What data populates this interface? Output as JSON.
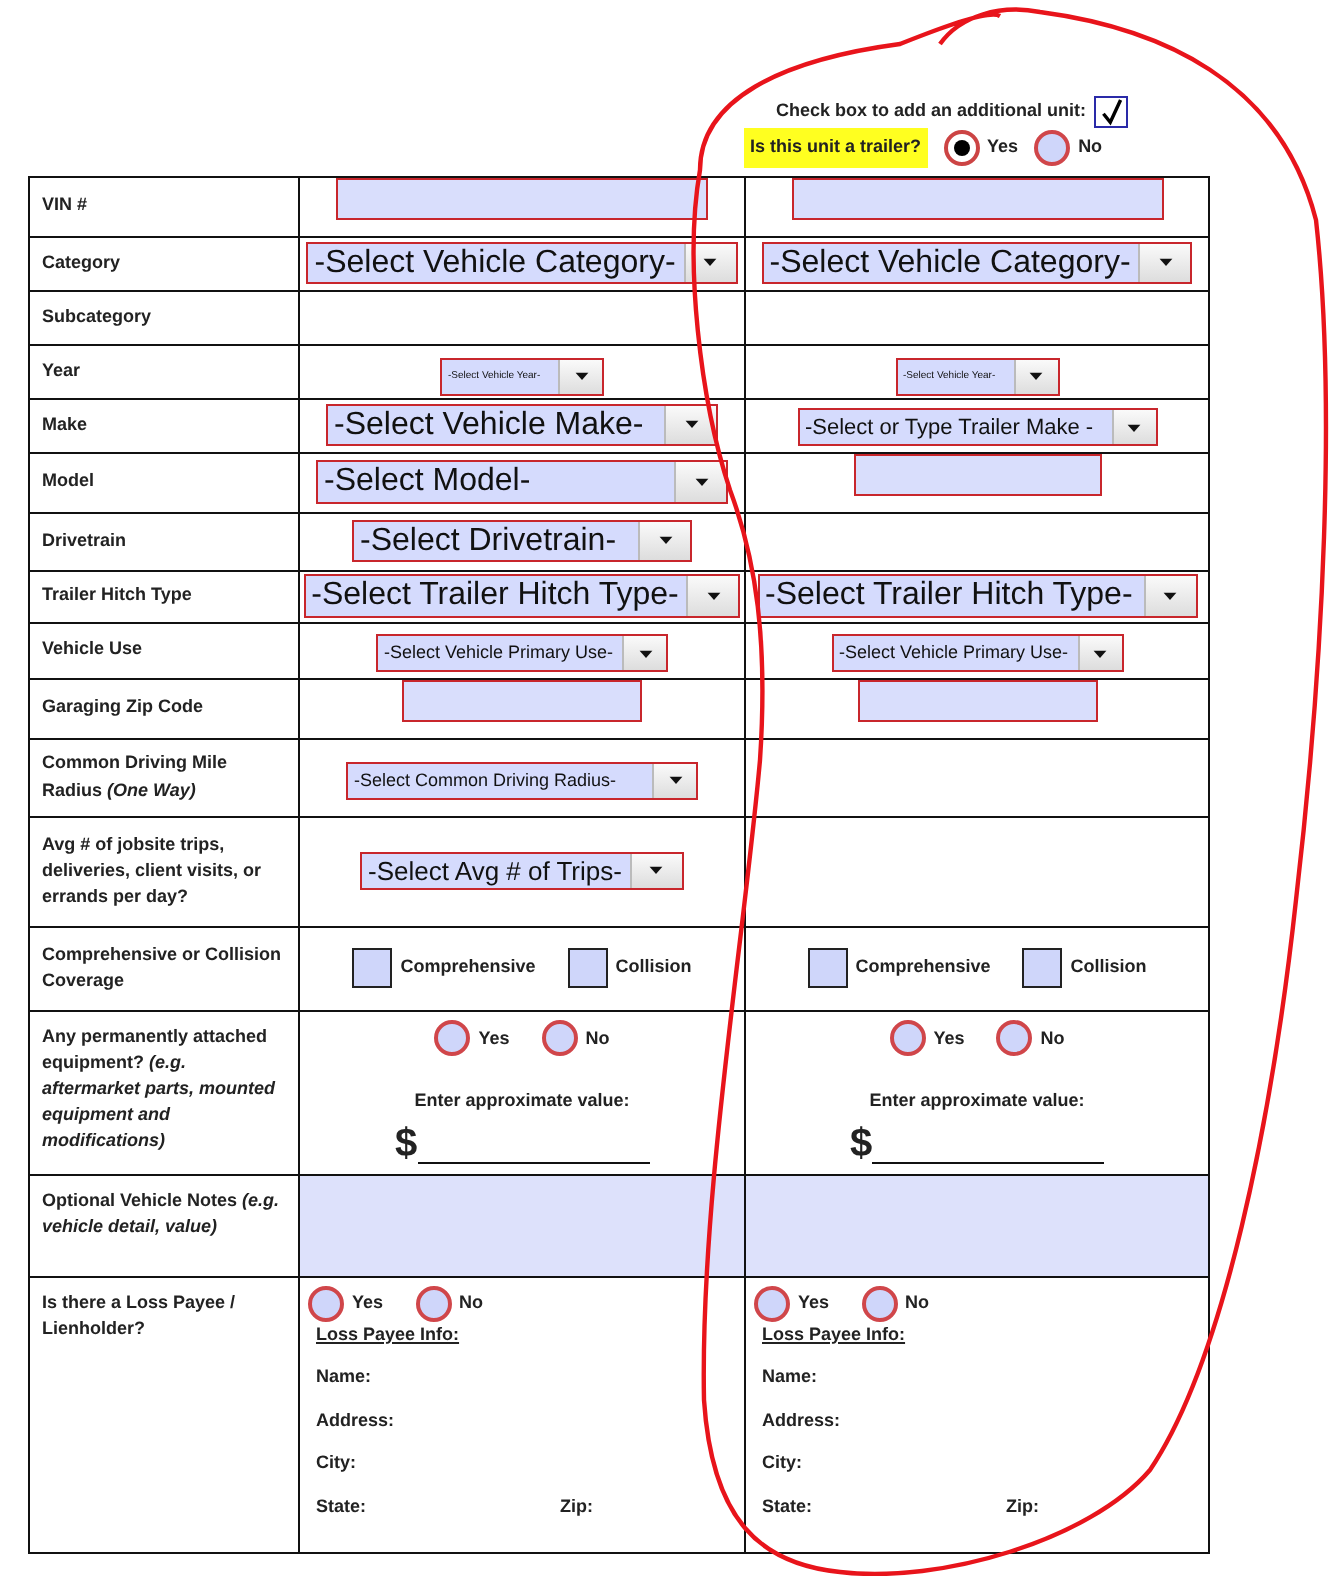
{
  "header": {
    "add_unit": {
      "label": "Check box to add an additional unit:",
      "checked": true
    },
    "trailer": {
      "question": "Is this unit a trailer?",
      "options": [
        {
          "label": "Yes",
          "selected": true
        },
        {
          "label": "No",
          "selected": false
        }
      ]
    }
  },
  "rows": [
    {
      "label": "VIN #",
      "cells": [
        {
          "kind": "input"
        },
        {
          "kind": "input"
        }
      ]
    },
    {
      "label": "Category",
      "cells": [
        {
          "kind": "select",
          "text": "-Select Vehicle Category-"
        },
        {
          "kind": "select",
          "text": "-Select Vehicle Category-"
        }
      ]
    },
    {
      "label": "Subcategory",
      "cells": [
        {
          "kind": "empty"
        },
        {
          "kind": "empty"
        }
      ]
    },
    {
      "label": "Year",
      "cells": [
        {
          "kind": "select",
          "text": "-Select Vehicle Year-"
        },
        {
          "kind": "select",
          "text": "-Select Vehicle Year-"
        }
      ]
    },
    {
      "label": "Make",
      "cells": [
        {
          "kind": "select",
          "text": "-Select Vehicle Make-"
        },
        {
          "kind": "select",
          "text": "-Select or Type Trailer Make -"
        }
      ]
    },
    {
      "label": "Model",
      "cells": [
        {
          "kind": "select",
          "text": "-Select Model-"
        },
        {
          "kind": "input"
        }
      ]
    },
    {
      "label": "Drivetrain",
      "cells": [
        {
          "kind": "select",
          "text": "-Select Drivetrain-"
        },
        {
          "kind": "empty"
        }
      ]
    },
    {
      "label": "Trailer Hitch Type",
      "cells": [
        {
          "kind": "select",
          "text": "-Select Trailer Hitch Type-"
        },
        {
          "kind": "select",
          "text": "-Select Trailer Hitch Type-"
        }
      ]
    },
    {
      "label": "Vehicle Use",
      "cells": [
        {
          "kind": "select",
          "text": "-Select Vehicle Primary Use-"
        },
        {
          "kind": "select",
          "text": "-Select Vehicle Primary Use-"
        }
      ]
    },
    {
      "label": "Garaging Zip Code",
      "cells": [
        {
          "kind": "input"
        },
        {
          "kind": "input"
        }
      ]
    },
    {
      "label": "Common Driving Mile Radius *(One Way)*",
      "cells": [
        {
          "kind": "select",
          "text": "-Select Common Driving Radius-"
        },
        {
          "kind": "empty"
        }
      ]
    },
    {
      "label": "Avg # of jobsite trips, deliveries, client visits, or errands per day?",
      "cells": [
        {
          "kind": "select",
          "text": "-Select Avg # of Trips-"
        },
        {
          "kind": "empty"
        }
      ]
    },
    {
      "label": "Comprehensive or Collision Coverage",
      "cells": [
        {
          "kind": "checkboxes",
          "options": [
            {
              "label": "Comprehensive",
              "checked": false
            },
            {
              "label": "Collision",
              "checked": false
            }
          ]
        },
        {
          "kind": "checkboxes",
          "options": [
            {
              "label": "Comprehensive",
              "checked": false
            },
            {
              "label": "Collision",
              "checked": false
            }
          ]
        }
      ]
    },
    {
      "label": "Any permanently attached equipment? *(e.g. aftermarket parts, mounted equipment and modifications)*",
      "cells": [
        {
          "kind": "equipment",
          "options": [
            {
              "label": "Yes",
              "selected": false
            },
            {
              "label": "No",
              "selected": false
            }
          ],
          "value_label": "Enter approximate value:",
          "currency": "$"
        },
        {
          "kind": "equipment",
          "options": [
            {
              "label": "Yes",
              "selected": false
            },
            {
              "label": "No",
              "selected": false
            }
          ],
          "value_label": "Enter approximate value:",
          "currency": "$"
        }
      ]
    },
    {
      "label": "Optional Vehicle Notes *(e.g. vehicle detail, value)*",
      "cells": [
        {
          "kind": "notes"
        },
        {
          "kind": "notes"
        }
      ]
    },
    {
      "label": "Is there a Loss Payee / Lienholder?",
      "cells": [
        {
          "kind": "loss_payee",
          "options": [
            {
              "label": "Yes",
              "selected": false
            },
            {
              "label": "No",
              "selected": false
            }
          ],
          "heading": "Loss Payee Info:",
          "lines": [
            [
              "Name:"
            ],
            [
              "Address:"
            ],
            [
              "City:"
            ],
            [
              "State:",
              "Zip:"
            ]
          ]
        },
        {
          "kind": "loss_payee",
          "options": [
            {
              "label": "Yes",
              "selected": false
            },
            {
              "label": "No",
              "selected": false
            }
          ],
          "heading": "Loss Payee Info:",
          "lines": [
            [
              "Name:"
            ],
            [
              "Address:"
            ],
            [
              "City:"
            ],
            [
              "State:",
              "Zip:"
            ]
          ]
        }
      ]
    }
  ]
}
